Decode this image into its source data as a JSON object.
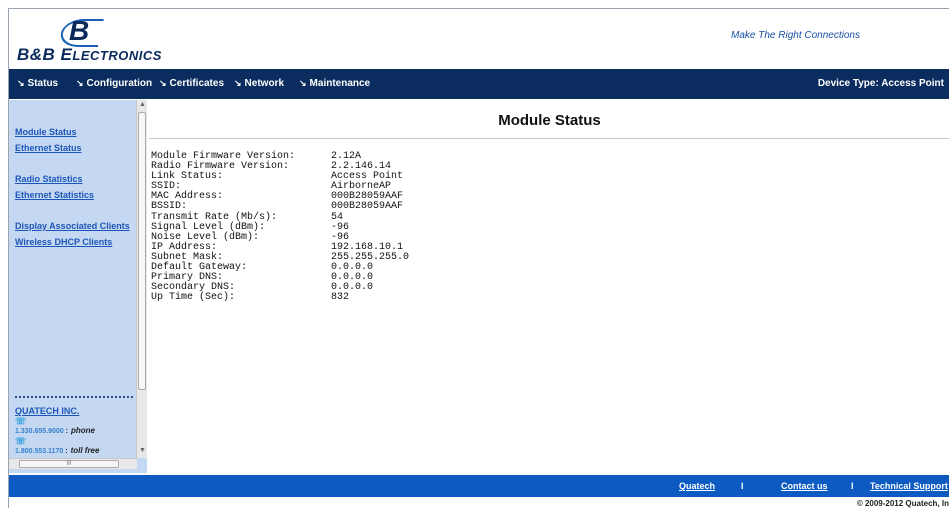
{
  "brand": {
    "logo_mark": "B",
    "logo_text_a": "B&B E",
    "logo_text_b": "LECTRONICS",
    "tagline": "Make The Right Connections"
  },
  "nav": {
    "items": [
      {
        "label": "Status"
      },
      {
        "label": "Configuration"
      },
      {
        "label": "Certificates"
      },
      {
        "label": "Network"
      },
      {
        "label": "Maintenance"
      }
    ],
    "arrow_glyph": "↘",
    "device_type": "Device Type: Access Point"
  },
  "sidebar": {
    "links": [
      "Module Status",
      "Ethernet Status",
      "Radio Statistics",
      "Ethernet Statistics",
      "Display Associated Clients",
      "Wireless DHCP Clients"
    ],
    "company": "QUATECH INC.",
    "phone": {
      "number": "1.330.655.9000",
      "label": "phone"
    },
    "toll_free": {
      "number": "1.800.553.1170",
      "label": "toll free"
    },
    "scroll_thumb_glyph": "III"
  },
  "main": {
    "title": "Module Status",
    "status": [
      {
        "key": "Module Firmware Version:",
        "value": "2.12A"
      },
      {
        "key": "Radio Firmware Version:",
        "value": "2.2.146.14"
      },
      {
        "key": "Link Status:",
        "value": "Access Point"
      },
      {
        "key": "SSID:",
        "value": "AirborneAP"
      },
      {
        "key": "MAC Address:",
        "value": "000B28059AAF"
      },
      {
        "key": "BSSID:",
        "value": "000B28059AAF"
      },
      {
        "key": "Transmit Rate (Mb/s):",
        "value": "54"
      },
      {
        "key": "Signal Level (dBm):",
        "value": "-96"
      },
      {
        "key": "Noise Level (dBm):",
        "value": "-96"
      },
      {
        "key": "IP Address:",
        "value": "192.168.10.1"
      },
      {
        "key": "Subnet Mask:",
        "value": "255.255.255.0"
      },
      {
        "key": "Default Gateway:",
        "value": "0.0.0.0"
      },
      {
        "key": "Primary DNS:",
        "value": "0.0.0.0"
      },
      {
        "key": "Secondary DNS:",
        "value": "0.0.0.0"
      },
      {
        "key": "Up Time (Sec):",
        "value": "832"
      }
    ]
  },
  "footer": {
    "links": [
      "Quatech",
      "Contact us",
      "Technical Support"
    ],
    "separator": "I",
    "copyright": "© 2009-2012 Quatech, In"
  },
  "colors": {
    "nav_bg": "#0b2c5e",
    "sidebar_bg": "#c4d8f2",
    "footer_bg": "#0d5bc2",
    "link": "#1d56b8"
  }
}
